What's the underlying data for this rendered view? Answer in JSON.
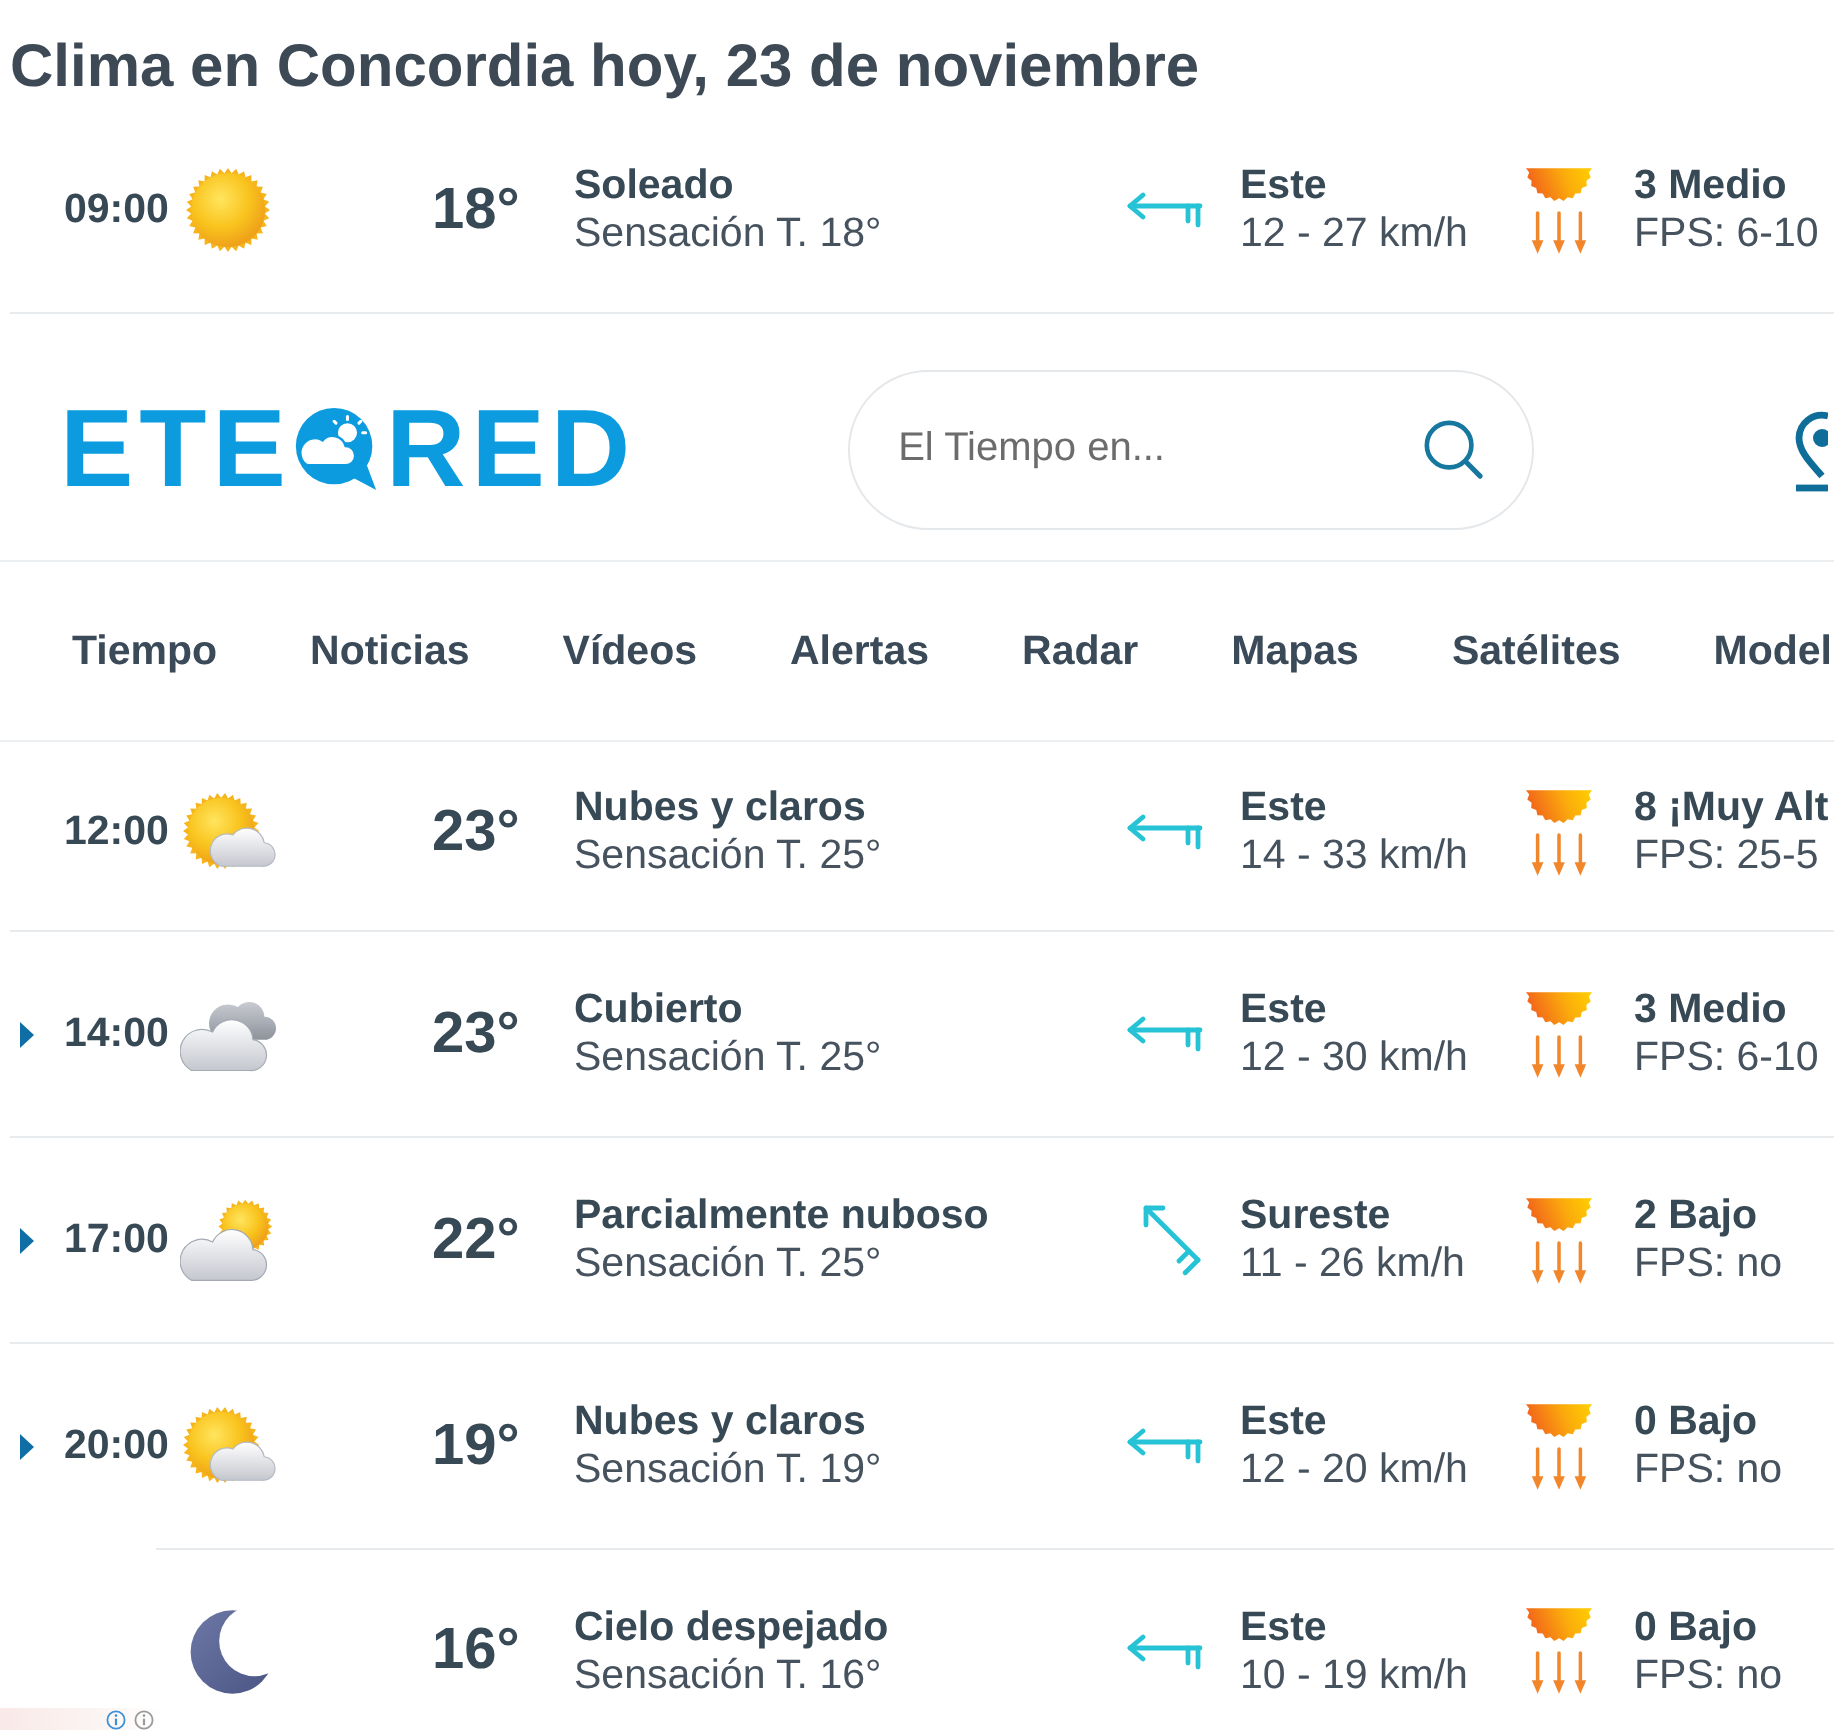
{
  "title": "Clima en Concordia hoy, 23 de noviembre",
  "top_hours": [
    {
      "time": "09:00",
      "expandable": false,
      "kind": "sun",
      "temp": "18°",
      "condition": "Soleado",
      "feels_like": "Sensación T. 18°",
      "wind": {
        "kind": "west",
        "direction": "Este",
        "speed": "12 - 27 km/h"
      },
      "uv": "3 Medio",
      "fps": "FPS: 6-10"
    }
  ],
  "header": {
    "logo": {
      "left": "ETE",
      "right": "RED"
    },
    "search": {
      "placeholder": "El Tiempo en..."
    }
  },
  "nav": [
    {
      "label": "Tiempo"
    },
    {
      "label": "Noticias"
    },
    {
      "label": "Vídeos"
    },
    {
      "label": "Alertas"
    },
    {
      "label": "Radar"
    },
    {
      "label": "Mapas"
    },
    {
      "label": "Satélites"
    },
    {
      "label": "Model"
    }
  ],
  "hours": [
    {
      "time": "12:00",
      "expandable": false,
      "kind": "sun-cloud",
      "temp": "23°",
      "condition": "Nubes y claros",
      "feels_like": "Sensación T. 25°",
      "wind": {
        "kind": "west",
        "direction": "Este",
        "speed": "14 - 33 km/h"
      },
      "uv": "8 ¡Muy Alt",
      "fps": "FPS: 25-5"
    },
    {
      "time": "14:00",
      "expandable": true,
      "kind": "clouds",
      "temp": "23°",
      "condition": "Cubierto",
      "feels_like": "Sensación T. 25°",
      "wind": {
        "kind": "west",
        "direction": "Este",
        "speed": "12 - 30 km/h"
      },
      "uv": "3 Medio",
      "fps": "FPS: 6-10"
    },
    {
      "time": "17:00",
      "expandable": true,
      "kind": "cloud-sun",
      "temp": "22°",
      "condition": "Parcialmente nuboso",
      "feels_like": "Sensación T. 25°",
      "wind": {
        "kind": "northwest",
        "direction": "Sureste",
        "speed": "11 - 26 km/h"
      },
      "uv": "2 Bajo",
      "fps": "FPS: no"
    },
    {
      "time": "20:00",
      "expandable": true,
      "kind": "sun-cloud",
      "temp": "19°",
      "condition": "Nubes y claros",
      "feels_like": "Sensación T. 19°",
      "wind": {
        "kind": "west",
        "direction": "Este",
        "speed": "12 - 20 km/h"
      },
      "uv": "0 Bajo",
      "fps": "FPS: no"
    },
    {
      "kind": "moon",
      "temp": "16°",
      "condition": "Cielo despejado",
      "feels_like": "Sensación T. 16°",
      "wind": {
        "kind": "west",
        "direction": "Este",
        "speed": "10 - 19 km/h"
      },
      "uv": "0 Bajo",
      "fps": "FPS: no"
    }
  ]
}
